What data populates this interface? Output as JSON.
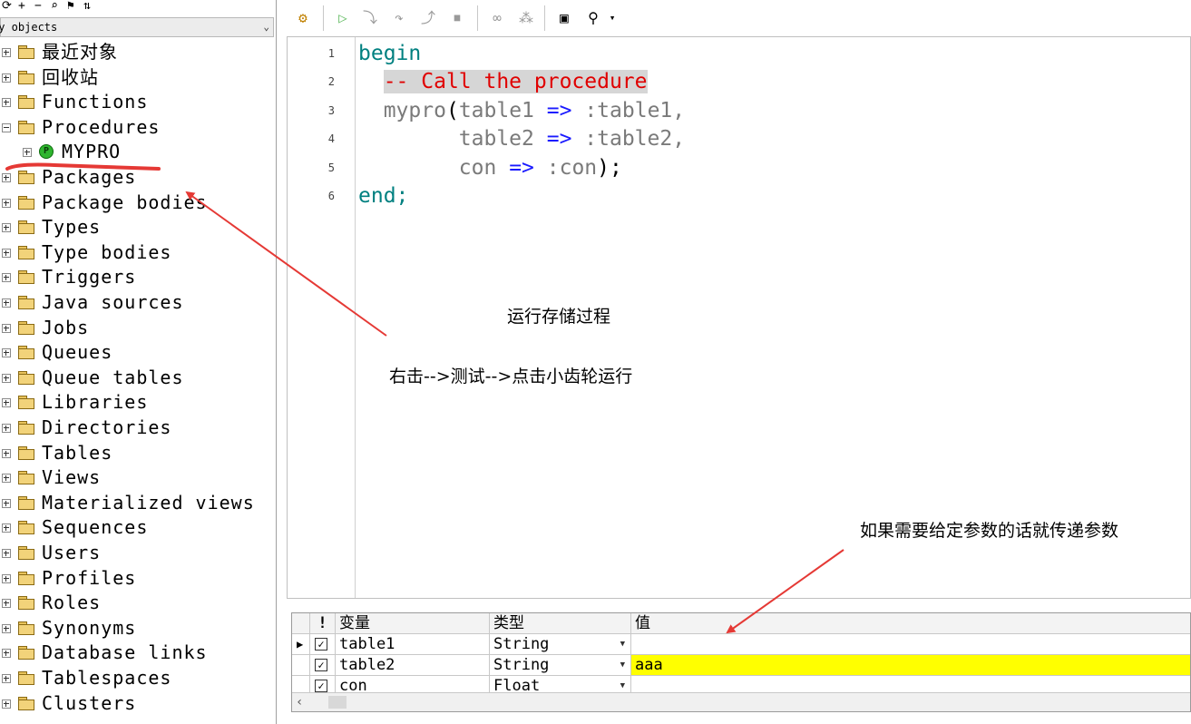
{
  "object_browser": {
    "filter_label": "My objects",
    "tree": [
      {
        "label": "最近对象",
        "expanded": false
      },
      {
        "label": "回收站",
        "expanded": false
      },
      {
        "label": "Functions",
        "expanded": false
      },
      {
        "label": "Procedures",
        "expanded": true
      },
      {
        "label": "MYPRO",
        "child": true
      },
      {
        "label": "Packages",
        "expanded": false
      },
      {
        "label": "Package bodies",
        "expanded": false
      },
      {
        "label": "Types",
        "expanded": false
      },
      {
        "label": "Type bodies",
        "expanded": false
      },
      {
        "label": "Triggers",
        "expanded": false
      },
      {
        "label": "Java sources",
        "expanded": false
      },
      {
        "label": "Jobs",
        "expanded": false
      },
      {
        "label": "Queues",
        "expanded": false
      },
      {
        "label": "Queue tables",
        "expanded": false
      },
      {
        "label": "Libraries",
        "expanded": false
      },
      {
        "label": "Directories",
        "expanded": false
      },
      {
        "label": "Tables",
        "expanded": false
      },
      {
        "label": "Views",
        "expanded": false
      },
      {
        "label": "Materialized views",
        "expanded": false
      },
      {
        "label": "Sequences",
        "expanded": false
      },
      {
        "label": "Users",
        "expanded": false
      },
      {
        "label": "Profiles",
        "expanded": false
      },
      {
        "label": "Roles",
        "expanded": false
      },
      {
        "label": "Synonyms",
        "expanded": false
      },
      {
        "label": "Database links",
        "expanded": false
      },
      {
        "label": "Tablespaces",
        "expanded": false
      },
      {
        "label": "Clusters",
        "expanded": false
      }
    ]
  },
  "editor": {
    "line_numbers": [
      "1",
      "2",
      "3",
      "4",
      "5",
      "6"
    ],
    "code": {
      "l1_kw": "begin",
      "l2_comment": "-- Call the procedure",
      "l3_name": "mypro",
      "l3_paren": "(",
      "l3_arg": "table1",
      "l3_op": "=>",
      "l3_bind": ":table1,",
      "l4_arg": "table2",
      "l4_op": "=>",
      "l4_bind": ":table2,",
      "l5_arg": "con",
      "l5_op": "=>",
      "l5_bind": ":con",
      "l5_end": ");",
      "l6_kw": "end;"
    }
  },
  "annotations": {
    "run_procedure": "运行存储过程",
    "steps": "右击-->测试-->点击小齿轮运行",
    "pass_params": "如果需要给定参数的话就传递参数"
  },
  "params_grid": {
    "headers": {
      "flag": "!",
      "variable": "变量",
      "type": "类型",
      "value": "值"
    },
    "rows": [
      {
        "checked": "✓",
        "variable": "table1",
        "type": "String",
        "value": ""
      },
      {
        "checked": "✓",
        "variable": "table2",
        "type": "String",
        "value": "aaa"
      },
      {
        "checked": "✓",
        "variable": "con",
        "type": "Float",
        "value": ""
      }
    ],
    "highlight_color": "#ffff00"
  },
  "colors": {
    "keyword": "#008080",
    "comment": "#e00000",
    "operator": "#1a1aff",
    "annotation_arrow": "#e53935"
  }
}
